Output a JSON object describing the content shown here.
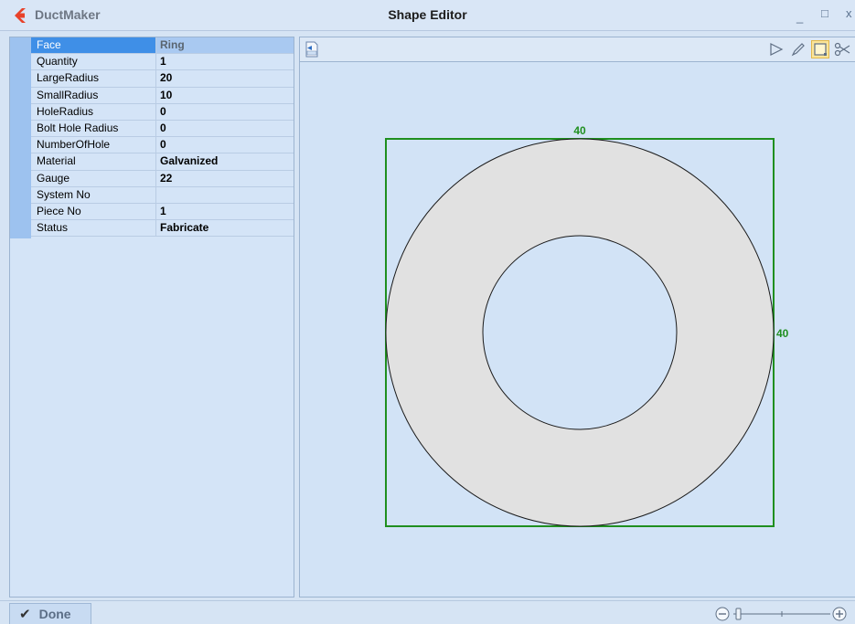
{
  "window": {
    "app_name": "DuctMaker",
    "title": "Shape Editor",
    "controls": {
      "minimize": "_",
      "maximize": "□",
      "close": "x"
    },
    "logo_color": "#e8422a"
  },
  "properties": [
    {
      "name": "Face",
      "value": "Ring",
      "selected": true
    },
    {
      "name": "Quantity",
      "value": "1"
    },
    {
      "name": "LargeRadius",
      "value": "20"
    },
    {
      "name": "SmallRadius",
      "value": "10"
    },
    {
      "name": "HoleRadius",
      "value": "0"
    },
    {
      "name": "Bolt Hole Radius",
      "value": "0"
    },
    {
      "name": "NumberOfHole",
      "value": "0"
    },
    {
      "name": "Material",
      "value": "Galvanized"
    },
    {
      "name": "Gauge",
      "value": "22"
    },
    {
      "name": "System No",
      "value": ""
    },
    {
      "name": "Piece No",
      "value": "1"
    },
    {
      "name": "Status",
      "value": "Fabricate"
    }
  ],
  "toolbar": {
    "icons": [
      "dwg-export-icon",
      "pointer-icon",
      "pencil-icon",
      "rectangle-icon",
      "scissors-icon"
    ],
    "active_tool": "rectangle-icon"
  },
  "drawing": {
    "shape": "Ring",
    "width_label": "40",
    "height_label": "40",
    "outer_radius": 20,
    "inner_radius": 10,
    "ring_fill": "#e1e1e1",
    "bounding_box_color": "#1f8f1f",
    "dimension_color": "#1f8f1f"
  },
  "statusbar": {
    "done_label": "Done",
    "zoom_icons": [
      "zoom-out-icon",
      "zoom-in-icon"
    ]
  }
}
